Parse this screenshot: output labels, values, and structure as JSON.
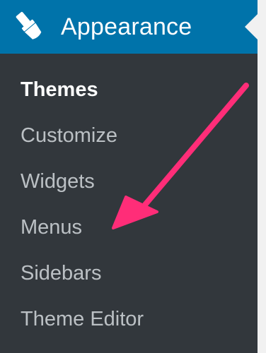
{
  "menu": {
    "header": {
      "label": "Appearance",
      "icon": "paintbrush-icon"
    },
    "items": [
      {
        "label": "Themes",
        "current": true
      },
      {
        "label": "Customize",
        "current": false
      },
      {
        "label": "Widgets",
        "current": false
      },
      {
        "label": "Menus",
        "current": false
      },
      {
        "label": "Sidebars",
        "current": false
      },
      {
        "label": "Theme Editor",
        "current": false
      }
    ]
  },
  "colors": {
    "header_background": "#0073aa",
    "menu_background": "#32373c",
    "page_background": "#f1f1f1",
    "arrow": "#ff2d78"
  }
}
